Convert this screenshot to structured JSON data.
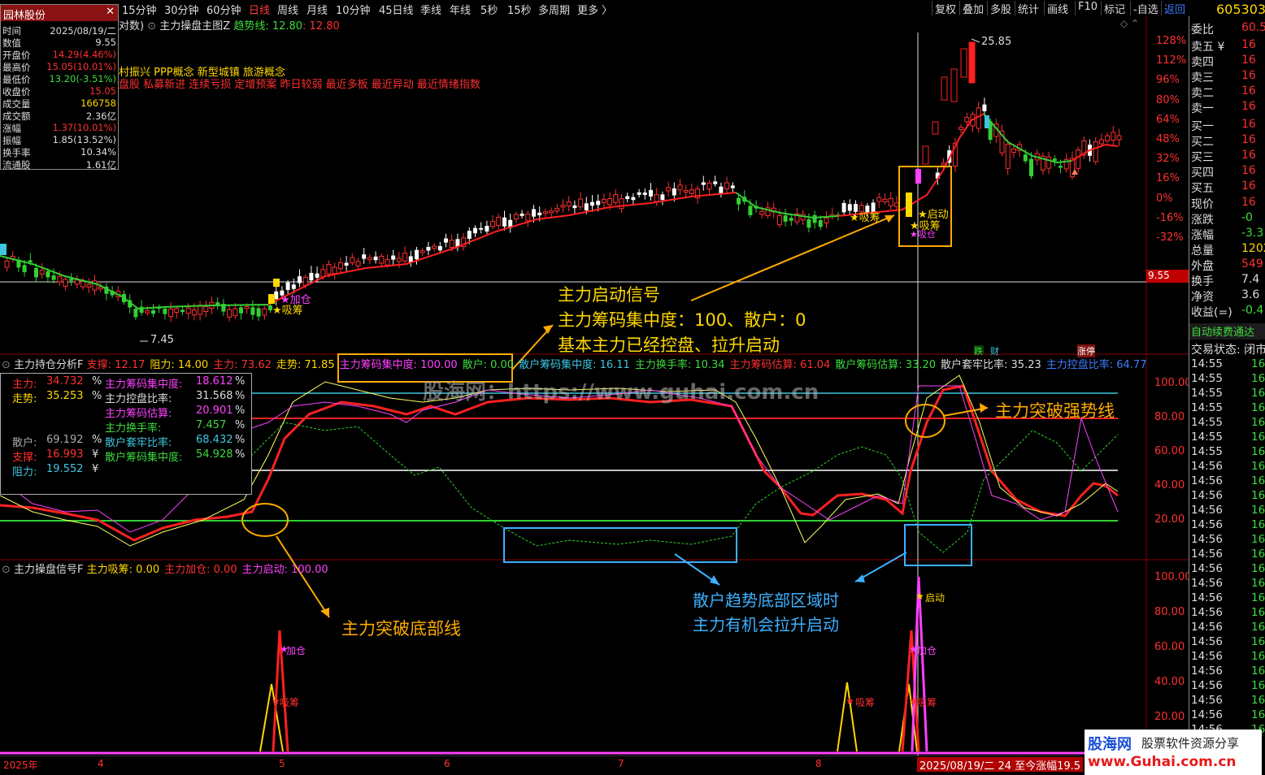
{
  "topbar": {
    "periods": [
      "15分钟",
      "30分钟",
      "60分钟",
      "日线",
      "周线",
      "月线",
      "10分钟",
      "45日线",
      "季线",
      "年线",
      "5秒",
      "15秒",
      "多周期",
      "更多 〉"
    ],
    "active_period": "日线",
    "right_buttons": [
      "复权",
      "叠加",
      "多股",
      "统计",
      "画线",
      "F10",
      "标记",
      "-自选",
      "返回"
    ],
    "stock_code": "605303"
  },
  "info_panel": {
    "title": "园林股份",
    "close_glyph": "✕",
    "rows": [
      {
        "label": "时间",
        "value": "2025/08/19/二",
        "color": "#dddddd"
      },
      {
        "label": "数值",
        "value": "9.55",
        "color": "#dddddd"
      },
      {
        "label": "开盘价",
        "value": "14.29(4.46%)",
        "color": "#ff3030"
      },
      {
        "label": "最高价",
        "value": "15.05(10.01%)",
        "color": "#ff3030"
      },
      {
        "label": "最低价",
        "value": "13.20(-3.51%)",
        "color": "#3ddc3d"
      },
      {
        "label": "收盘价",
        "value": "15.05",
        "color": "#ff3030"
      },
      {
        "label": "成交量",
        "value": "166758",
        "color": "#ffd800"
      },
      {
        "label": "成交额",
        "value": "2.36亿",
        "color": "#dddddd"
      },
      {
        "label": "涨幅",
        "value": "1.37(10.01%)",
        "color": "#ff3030"
      },
      {
        "label": "振幅",
        "value": "1.85(13.52%)",
        "color": "#dddddd"
      },
      {
        "label": "换手率",
        "value": "10.34%",
        "color": "#dddddd"
      },
      {
        "label": "流通股",
        "value": "1.61亿",
        "color": "#dddddd"
      }
    ]
  },
  "main_chart": {
    "header_prefix": "对数)",
    "indicator_name": "主力操盘主图Z",
    "trend_label": "趋势线: 12.80",
    "trend_value2": ": 12.80",
    "concepts_line1": "村振兴 PPP概念 新型城镇 旅游概念",
    "concepts_line2": "盘股 私募新进 连续亏损 定增预案 昨日较弱 最近多板 最近异动 最近情绪指数",
    "price_high_label": "25.85",
    "price_low_label": "7.45",
    "cursor_price": "9.55",
    "y_ticks": [
      "128%",
      "112%",
      "96%",
      "80%",
      "64%",
      "48%",
      "32%",
      "16%",
      "0%",
      "-16%",
      "-32%"
    ],
    "labels": {
      "xichou": "吸筹",
      "jiacang": "加仓",
      "qidong": "启动",
      "xicang": "吸仓"
    },
    "small_marks": [
      "跌",
      "财",
      "涨停"
    ]
  },
  "annotations": {
    "signal_lines": [
      "主力启动信号",
      "主力筹码集中度：100、散户：0",
      "基本主力已经控盘、拉升启动"
    ],
    "break_bottom": "主力突破底部线",
    "break_strong": "主力突破强势线",
    "retail_bottom": [
      "散户趋势底部区域时",
      "主力有机会拉升启动"
    ]
  },
  "middle_panel": {
    "title": "主力持仓分析F",
    "header_items": [
      {
        "text": "支撑: 12.17",
        "color": "#ff3030"
      },
      {
        "text": "阻力: 14.00",
        "color": "#ffd800"
      },
      {
        "text": "主力: 73.62",
        "color": "#ff3030"
      },
      {
        "text": "走势: 71.85",
        "color": "#ffd800"
      },
      {
        "text": "主力筹码集中度: 100.00",
        "color": "#ff40ff"
      },
      {
        "text": "散户: 0.00",
        "color": "#3ddc3d"
      },
      {
        "text": "散户筹码集中度: 16.11",
        "color": "#3ec6e0"
      },
      {
        "text": "主力换手率: 10.34",
        "color": "#3ddc3d"
      },
      {
        "text": "主力筹码估算: 61.04",
        "color": "#ff3030"
      },
      {
        "text": "散户筹码估算: 33.20",
        "color": "#3ddc3d"
      },
      {
        "text": "散户套牢比率: 35.23",
        "color": "#dddddd"
      },
      {
        "text": "主力控盘比率: 64.77",
        "color": "#3c7bff"
      }
    ],
    "y_ticks": [
      "100.00",
      "80.00",
      "60.00",
      "40.00",
      "20.00"
    ],
    "legend": [
      {
        "l": "主力:",
        "v": "34.732",
        "u": "%",
        "lc": "#ff3030",
        "vc": "#ff3030"
      },
      {
        "l": "走势:",
        "v": "35.253",
        "u": "%",
        "lc": "#ffd800",
        "vc": "#ffd800"
      },
      {
        "l": "散户:",
        "v": "69.192",
        "u": "%",
        "lc": "#aaaaaa",
        "vc": "#aaaaaa"
      },
      {
        "l": "支撑:",
        "v": "16.993",
        "u": "¥",
        "lc": "#ff3030",
        "vc": "#ff3030"
      },
      {
        "l": "阻力:",
        "v": "19.552",
        "u": "¥",
        "lc": "#3ec6e0",
        "vc": "#3ec6e0"
      }
    ],
    "legend_right": [
      {
        "l": "主力筹码集中度:",
        "v": "18.612",
        "u": "%",
        "lc": "#ff40ff",
        "vc": "#ff40ff"
      },
      {
        "l": "主力控盘比率:",
        "v": "31.568",
        "u": "%",
        "lc": "#dddddd",
        "vc": "#dddddd"
      },
      {
        "l": "主力筹码估算:",
        "v": "20.901",
        "u": "%",
        "lc": "#ff40ff",
        "vc": "#ff40ff"
      },
      {
        "l": "主力换手率:",
        "v": "7.457",
        "u": "%",
        "lc": "#3ddc3d",
        "vc": "#3ddc3d"
      },
      {
        "l": "散户套牢比率:",
        "v": "68.432",
        "u": "%",
        "lc": "#3ec6e0",
        "vc": "#3ec6e0"
      },
      {
        "l": "散户筹码集中度:",
        "v": "54.928",
        "u": "%",
        "lc": "#3ddc3d",
        "vc": "#3ddc3d"
      }
    ]
  },
  "bottom_panel": {
    "title": "主力操盘信号F",
    "header_items": [
      {
        "text": "主力吸筹: 0.00",
        "color": "#ffd800"
      },
      {
        "text": "主力加仓: 0.00",
        "color": "#ff3030"
      },
      {
        "text": "主力启动: 100.00",
        "color": "#ff40ff"
      }
    ],
    "y_ticks": [
      "100.00",
      "80.00",
      "60.00",
      "40.00",
      "20.00"
    ],
    "labels": {
      "jiacang": "加仓",
      "xichou": "吸筹",
      "qidong": "启动"
    }
  },
  "watermark": "股海网：https://www.guhai.com.cn",
  "bottom_axis": {
    "labels": [
      "2025年",
      "4",
      "5",
      "6",
      "7",
      "8"
    ],
    "date_tip": "2025/08/19/二 24 至今涨幅19.5"
  },
  "right_panel": {
    "weibi": {
      "label": "委比",
      "value": "60.5"
    },
    "rows": [
      {
        "l": "卖五 ¥",
        "v": "16"
      },
      {
        "l": "卖四",
        "v": "16"
      },
      {
        "l": "卖三",
        "v": "16"
      },
      {
        "l": "卖二",
        "v": "16"
      },
      {
        "l": "卖一",
        "v": "16"
      },
      {
        "l": "买一",
        "v": "16"
      },
      {
        "l": "买二",
        "v": "16"
      },
      {
        "l": "买三",
        "v": "16"
      },
      {
        "l": "买四",
        "v": "16"
      },
      {
        "l": "买五",
        "v": "16"
      }
    ],
    "stats": [
      {
        "l": "现价",
        "v": "16",
        "c": "#ff3030"
      },
      {
        "l": "涨跌",
        "v": "-0",
        "c": "#3ddc3d"
      },
      {
        "l": "涨幅",
        "v": "-3.3",
        "c": "#3ddc3d"
      },
      {
        "l": "总量",
        "v": "1202",
        "c": "#ffd800"
      },
      {
        "l": "外盘",
        "v": "549",
        "c": "#ff3030"
      },
      {
        "l": "换手",
        "v": "7.4",
        "c": "#dddddd"
      },
      {
        "l": "净资",
        "v": "3.6",
        "c": "#dddddd"
      },
      {
        "l": "收益(=)",
        "v": "-0.4",
        "c": "#3ddc3d"
      }
    ],
    "notice": "自动续费通达",
    "trade_status": "交易状态: 闭市",
    "ticks": [
      "14:55",
      "14:55",
      "14:55",
      "14:55",
      "14:55",
      "14:55",
      "14:55",
      "14:56",
      "14:56",
      "14:56",
      "14:56",
      "14:56",
      "14:56",
      "14:56",
      "14:56",
      "14:56",
      "14:56",
      "14:56",
      "14:56",
      "14:56",
      "14:56",
      "14:56",
      "14:56",
      "14:56",
      "14:56",
      "14:56"
    ],
    "tick_value": "16"
  },
  "logo": {
    "line1": "股海网",
    "line1b": "股票软件资源分享",
    "line2": "www.Guhai.com.cn"
  }
}
